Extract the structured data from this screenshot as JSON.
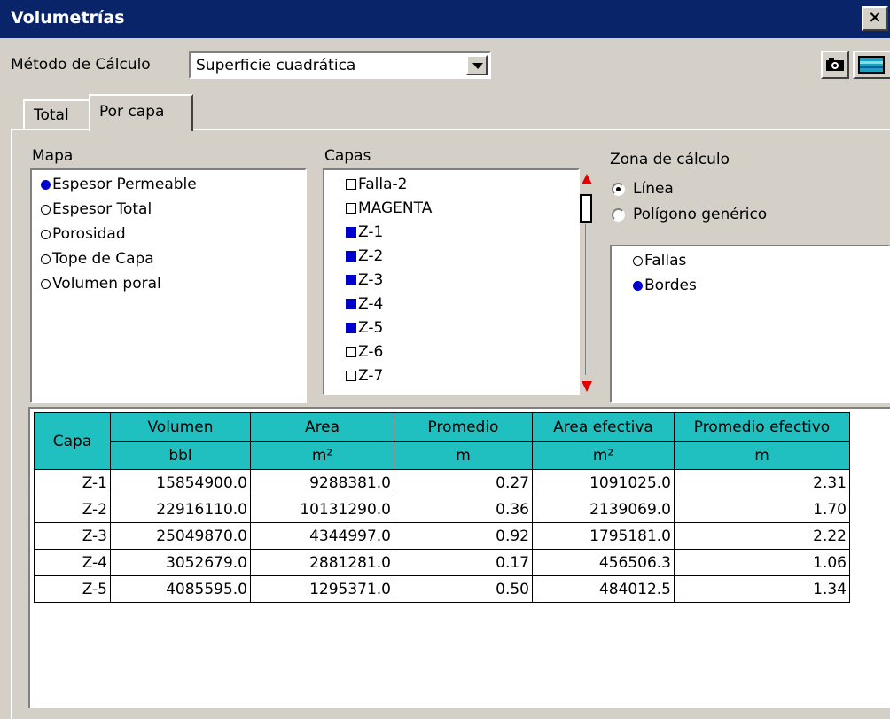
{
  "window": {
    "title": "Volumetrías",
    "close_label": "×"
  },
  "toolbar": {
    "method_label": "Método de Cálculo",
    "method_value": "Superficie cuadrática",
    "camera_icon": "camera-icon",
    "map_icon": "map-view-icon"
  },
  "tabs": [
    {
      "label": "Total"
    },
    {
      "label": "Por capa",
      "active": true
    }
  ],
  "mapa": {
    "title": "Mapa",
    "items": [
      {
        "label": "Espesor Permeable",
        "selected": true
      },
      {
        "label": "Espesor Total",
        "selected": false
      },
      {
        "label": "Porosidad",
        "selected": false
      },
      {
        "label": "Tope de Capa",
        "selected": false
      },
      {
        "label": "Volumen poral",
        "selected": false
      }
    ]
  },
  "capas": {
    "title": "Capas",
    "items": [
      {
        "label": "Falla-2",
        "checked": false
      },
      {
        "label": "MAGENTA",
        "checked": false
      },
      {
        "label": "Z-1",
        "checked": true
      },
      {
        "label": "Z-2",
        "checked": true
      },
      {
        "label": "Z-3",
        "checked": true
      },
      {
        "label": "Z-4",
        "checked": true
      },
      {
        "label": "Z-5",
        "checked": true
      },
      {
        "label": "Z-6",
        "checked": false
      },
      {
        "label": "Z-7",
        "checked": false
      }
    ]
  },
  "zona": {
    "title": "Zona de cálculo",
    "options": [
      {
        "label": "Línea",
        "selected": true
      },
      {
        "label": "Polígono genérico",
        "selected": false
      }
    ],
    "items": [
      {
        "label": "Fallas",
        "selected": false
      },
      {
        "label": "Bordes",
        "selected": true
      }
    ]
  },
  "table": {
    "first_header": "Capa",
    "columns": [
      {
        "name": "Volumen",
        "unit": "bbl"
      },
      {
        "name": "Area",
        "unit": "m²"
      },
      {
        "name": "Promedio",
        "unit": "m"
      },
      {
        "name": "Area efectiva",
        "unit": "m²"
      },
      {
        "name": "Promedio efectivo",
        "unit": "m"
      }
    ],
    "rows": [
      [
        "Z-1",
        "15854900.0",
        "9288381.0",
        "0.27",
        "1091025.0",
        "2.31"
      ],
      [
        "Z-2",
        "22916110.0",
        "10131290.0",
        "0.36",
        "2139069.0",
        "1.70"
      ],
      [
        "Z-3",
        "25049870.0",
        "4344997.0",
        "0.92",
        "1795181.0",
        "2.22"
      ],
      [
        "Z-4",
        "3052679.0",
        "2881281.0",
        "0.17",
        "456506.3",
        "1.06"
      ],
      [
        "Z-5",
        "4085595.0",
        "1295371.0",
        "0.50",
        "484012.5",
        "1.34"
      ]
    ]
  }
}
